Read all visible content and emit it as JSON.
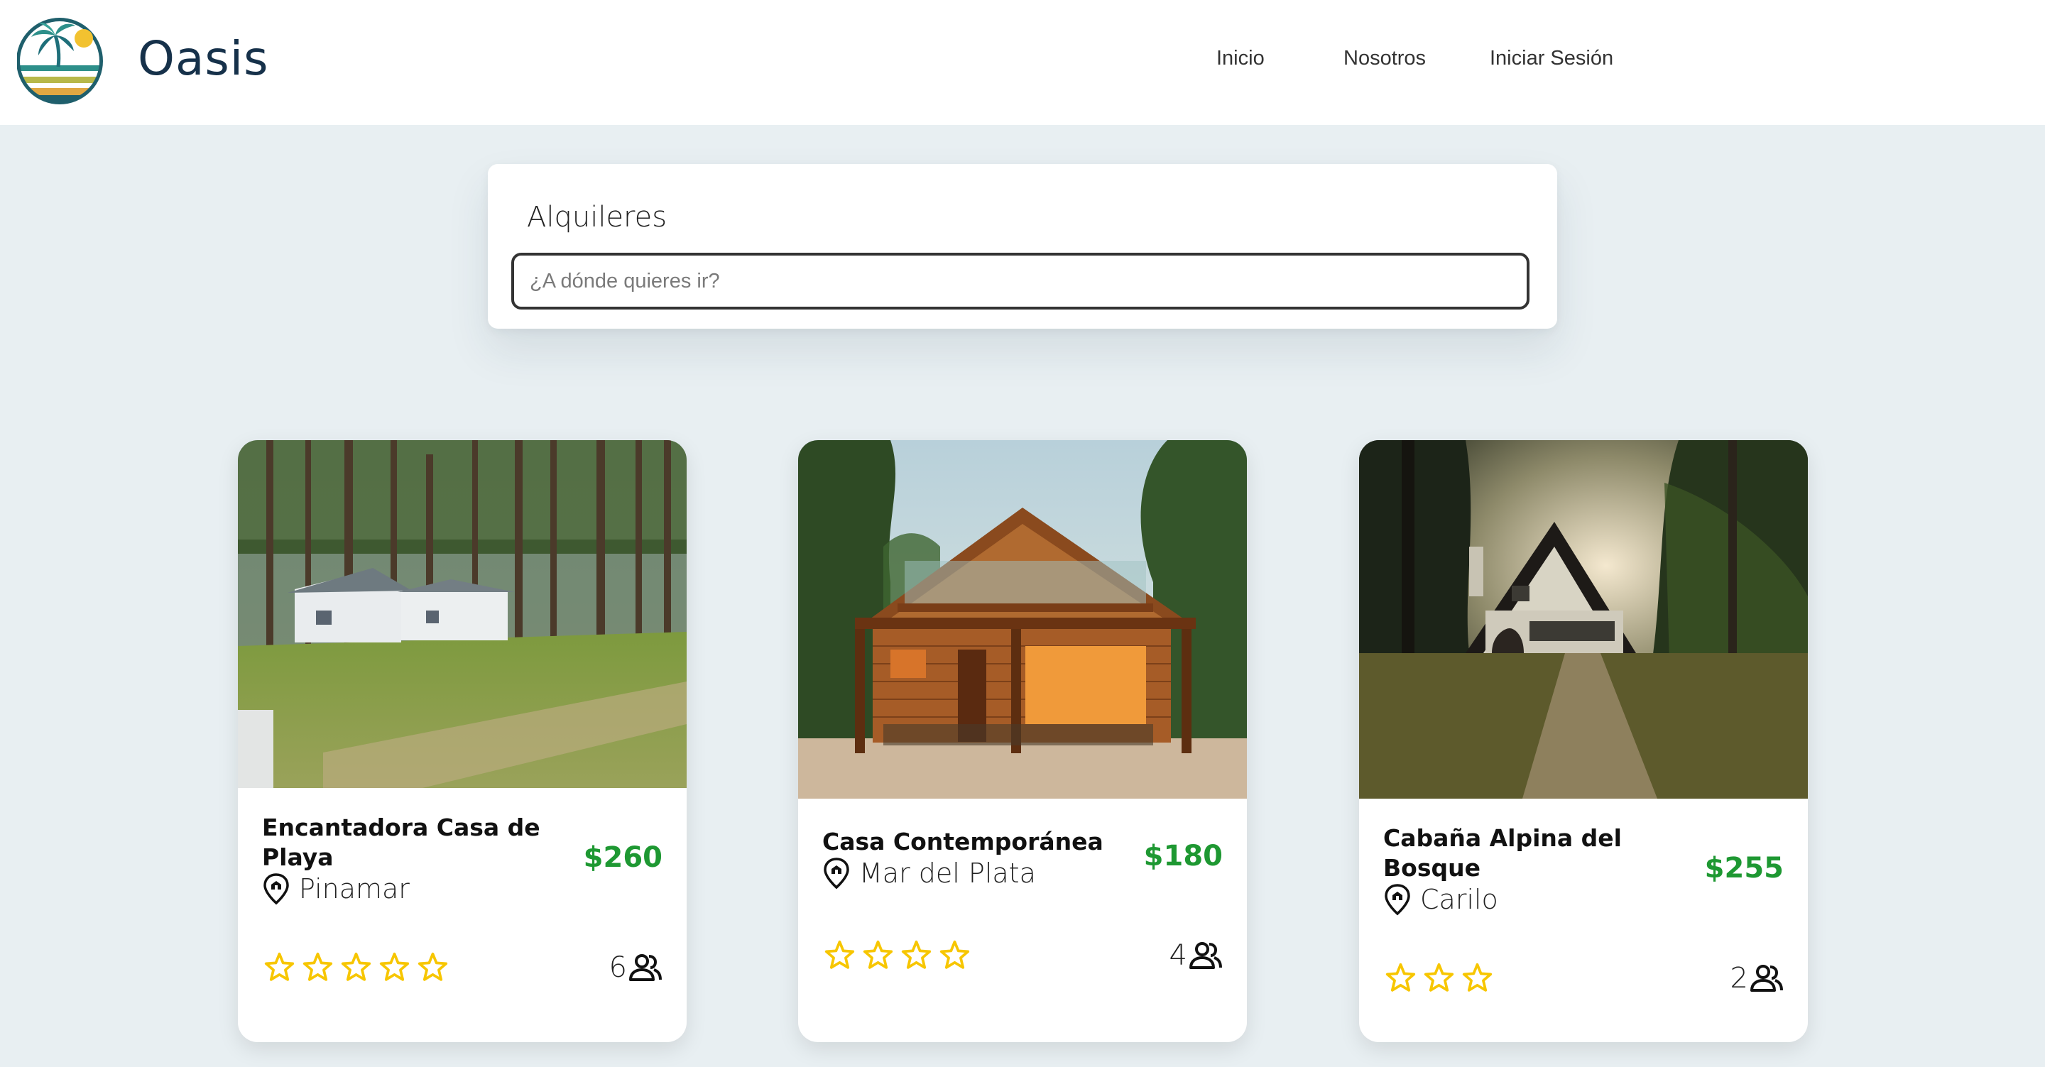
{
  "header": {
    "brand": "Oasis",
    "nav": [
      {
        "label": "Inicio"
      },
      {
        "label": "Nosotros"
      },
      {
        "label": "Iniciar Sesión"
      }
    ]
  },
  "search": {
    "title": "Alquileres",
    "placeholder": "¿A dónde quieres ir?",
    "value": ""
  },
  "listings": [
    {
      "title": "Encantadora Casa de Playa",
      "location": "Pinamar",
      "price": "$260",
      "rating": 5,
      "guests": "6"
    },
    {
      "title": "Casa Contemporánea",
      "location": "Mar del Plata",
      "price": "$180",
      "rating": 4,
      "guests": "4"
    },
    {
      "title": "Cabaña Alpina del Bosque",
      "location": "Carilo",
      "price": "$255",
      "rating": 3,
      "guests": "2"
    }
  ],
  "colors": {
    "page_bg": "#e8eff2",
    "brand_text": "#16314a",
    "price": "#1e9832",
    "star": "#f7c600"
  },
  "icons": {
    "logo": "palm-beach-sun-logo",
    "location": "location-pin-icon",
    "rating": "star-icon",
    "guests": "people-icon"
  }
}
